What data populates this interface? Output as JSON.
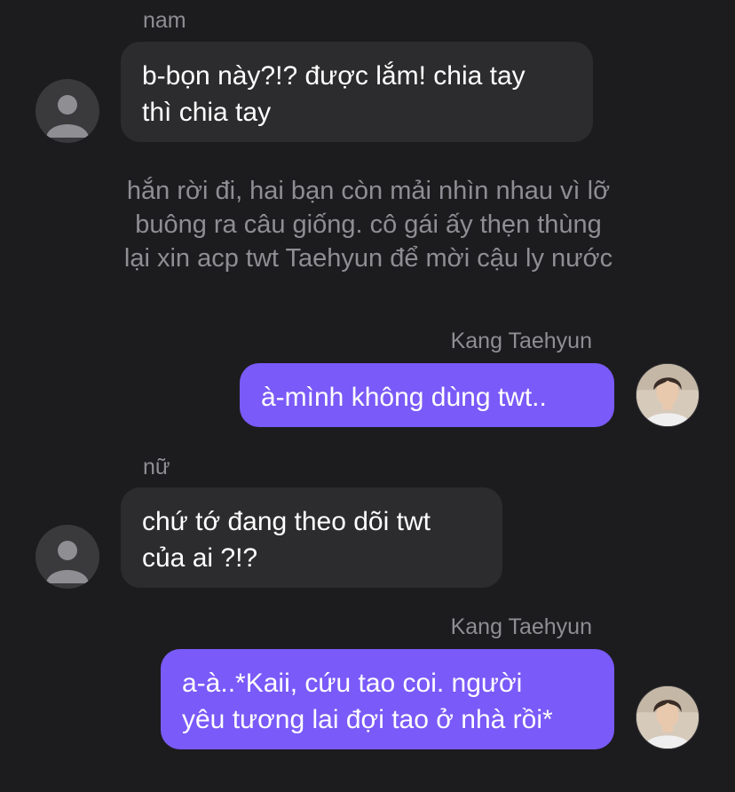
{
  "messages": [
    {
      "sender": "nam",
      "lines": [
        "b-bọn này?!? được lắm! chia tay",
        "thì chia tay"
      ],
      "avatar": "default-person-icon"
    },
    {
      "narration": [
        "hắn rời đi, hai bạn còn mải nhìn nhau vì lỡ",
        "buông ra câu giống. cô gái ấy thẹn thùng",
        "lại xin acp twt Taehyun để mời cậu ly nước"
      ]
    },
    {
      "sender": "Kang Taehyun",
      "lines": [
        "à-mình không dùng twt.."
      ],
      "avatar": "profile-photo"
    },
    {
      "sender": "nữ",
      "lines": [
        "chứ tớ đang theo dõi twt",
        "của ai ?!?"
      ],
      "avatar": "default-person-icon"
    },
    {
      "sender": "Kang Taehyun",
      "lines": [
        "a-à..*Kaii, cứu tao coi. người",
        "yêu tương lai đợi tao ở nhà rồi*"
      ],
      "avatar": "profile-photo"
    }
  ],
  "colors": {
    "background": "#1c1c1e",
    "incoming_bubble": "#2c2c2e",
    "outgoing_bubble": "#7a5af8",
    "muted_text": "#8e8e93"
  }
}
